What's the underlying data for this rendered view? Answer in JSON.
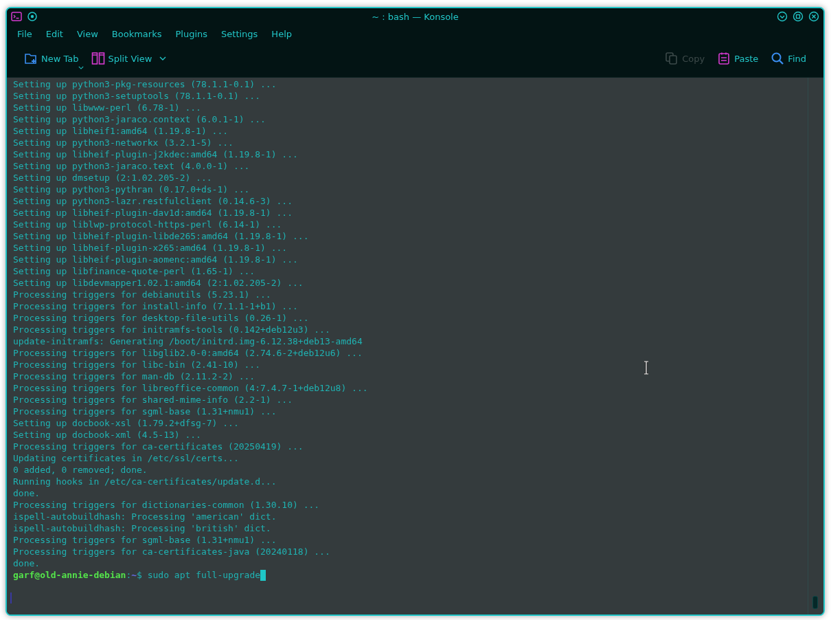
{
  "window": {
    "title": "~ : bash — Konsole"
  },
  "menu": [
    "File",
    "Edit",
    "View",
    "Bookmarks",
    "Plugins",
    "Settings",
    "Help"
  ],
  "toolbar": [
    {
      "kind": "new-tab",
      "label": "New Tab",
      "disabled": false,
      "dropdown": true
    },
    {
      "kind": "split-view",
      "label": "Split View",
      "disabled": false,
      "dropdown": true
    },
    {
      "kind": "copy",
      "label": "Copy",
      "disabled": true,
      "dropdown": false
    },
    {
      "kind": "paste",
      "label": "Paste",
      "disabled": false,
      "dropdown": false
    },
    {
      "kind": "find",
      "label": "Find",
      "disabled": false,
      "dropdown": false
    }
  ],
  "terminal": {
    "lines": [
      {
        "kind": "output",
        "text": "Setting up python3-pkg-resources (78.1.1-0.1) ..."
      },
      {
        "kind": "output",
        "text": "Setting up python3-setuptools (78.1.1-0.1) ..."
      },
      {
        "kind": "output",
        "text": "Setting up libwww-perl (6.78-1) ..."
      },
      {
        "kind": "output",
        "text": "Setting up python3-jaraco.context (6.0.1-1) ..."
      },
      {
        "kind": "output",
        "text": "Setting up libheif1:amd64 (1.19.8-1) ..."
      },
      {
        "kind": "output",
        "text": "Setting up python3-networkx (3.2.1-5) ..."
      },
      {
        "kind": "output",
        "text": "Setting up libheif-plugin-j2kdec:amd64 (1.19.8-1) ..."
      },
      {
        "kind": "output",
        "text": "Setting up python3-jaraco.text (4.0.0-1) ..."
      },
      {
        "kind": "output",
        "text": "Setting up dmsetup (2:1.02.205-2) ..."
      },
      {
        "kind": "output",
        "text": "Setting up python3-pythran (0.17.0+ds-1) ..."
      },
      {
        "kind": "output",
        "text": "Setting up python3-lazr.restfulclient (0.14.6-3) ..."
      },
      {
        "kind": "output",
        "text": "Setting up libheif-plugin-dav1d:amd64 (1.19.8-1) ..."
      },
      {
        "kind": "output",
        "text": "Setting up liblwp-protocol-https-perl (6.14-1) ..."
      },
      {
        "kind": "output",
        "text": "Setting up libheif-plugin-libde265:amd64 (1.19.8-1) ..."
      },
      {
        "kind": "output",
        "text": "Setting up libheif-plugin-x265:amd64 (1.19.8-1) ..."
      },
      {
        "kind": "output",
        "text": "Setting up libheif-plugin-aomenc:amd64 (1.19.8-1) ..."
      },
      {
        "kind": "output",
        "text": "Setting up libfinance-quote-perl (1.65-1) ..."
      },
      {
        "kind": "output",
        "text": "Setting up libdevmapper1.02.1:amd64 (2:1.02.205-2) ..."
      },
      {
        "kind": "output",
        "text": "Processing triggers for debianutils (5.23.1) ..."
      },
      {
        "kind": "output",
        "text": "Processing triggers for install-info (7.1.1-1+b1) ..."
      },
      {
        "kind": "output",
        "text": "Processing triggers for desktop-file-utils (0.26-1) ..."
      },
      {
        "kind": "output",
        "text": "Processing triggers for initramfs-tools (0.142+deb12u3) ..."
      },
      {
        "kind": "output",
        "text": "update-initramfs: Generating /boot/initrd.img-6.12.38+deb13-amd64"
      },
      {
        "kind": "output",
        "text": "Processing triggers for libglib2.0-0:amd64 (2.74.6-2+deb12u6) ..."
      },
      {
        "kind": "output",
        "text": "Processing triggers for libc-bin (2.41-10) ..."
      },
      {
        "kind": "output",
        "text": "Processing triggers for man-db (2.11.2-2) ..."
      },
      {
        "kind": "output",
        "text": "Processing triggers for libreoffice-common (4:7.4.7-1+deb12u8) ..."
      },
      {
        "kind": "output",
        "text": "Processing triggers for shared-mime-info (2.2-1) ..."
      },
      {
        "kind": "output",
        "text": "Processing triggers for sgml-base (1.31+nmu1) ..."
      },
      {
        "kind": "output",
        "text": "Setting up docbook-xsl (1.79.2+dfsg-7) ..."
      },
      {
        "kind": "output",
        "text": "Setting up docbook-xml (4.5-13) ..."
      },
      {
        "kind": "output",
        "text": "Processing triggers for ca-certificates (20250419) ..."
      },
      {
        "kind": "output",
        "text": "Updating certificates in /etc/ssl/certs..."
      },
      {
        "kind": "output",
        "text": "0 added, 0 removed; done."
      },
      {
        "kind": "output",
        "text": "Running hooks in /etc/ca-certificates/update.d..."
      },
      {
        "kind": "output",
        "text": "done."
      },
      {
        "kind": "output",
        "text": "Processing triggers for dictionaries-common (1.30.10) ..."
      },
      {
        "kind": "output",
        "text": "ispell-autobuildhash: Processing 'american' dict."
      },
      {
        "kind": "output",
        "text": "ispell-autobuildhash: Processing 'british' dict."
      },
      {
        "kind": "output",
        "text": "Processing triggers for sgml-base (1.31+nmu1) ..."
      },
      {
        "kind": "output",
        "text": "Processing triggers for ca-certificates-java (20240118) ..."
      },
      {
        "kind": "output",
        "text": "done."
      },
      {
        "kind": "prompt",
        "user_host": "garf@old-annie-debian",
        "separator": ":",
        "path": "~",
        "symbol": "$",
        "command": "sudo apt full-upgrade"
      }
    ]
  }
}
